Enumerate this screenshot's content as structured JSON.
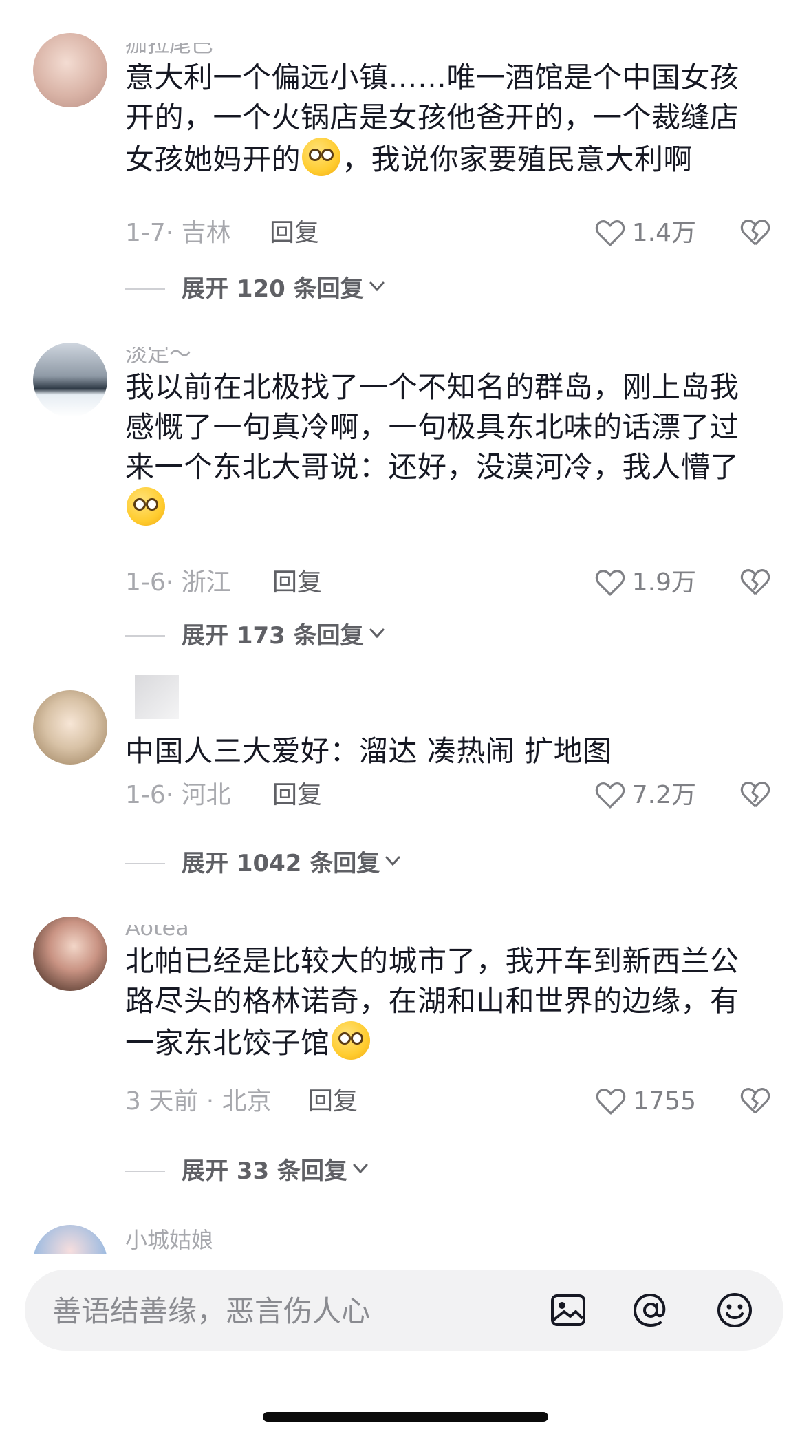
{
  "comments": [
    {
      "username": "痂拉尾巴",
      "text_before_emoji": "意大利一个偏远小镇……唯一酒馆是个中国女孩开的，一个火锅店是女孩他爸开的，一个裁缝店女孩她妈开的",
      "emoji": "face-with-wide-eyes-emoji",
      "text_after_emoji": "，我说你家要殖民意大利啊",
      "meta": "1-7· 吉林",
      "reply_label": "回复",
      "likes": "1.4万",
      "expand_label": "展开 120 条回复"
    },
    {
      "username": "淡定～",
      "text_before_emoji": "我以前在北极找了一个不知名的群岛，刚上岛我感慨了一句真冷啊，一句极具东北味的话漂了过来一个东北大哥说：还好，没漠河冷，我人懵了",
      "emoji": "dizzy-face-emoji",
      "text_after_emoji": "",
      "meta": "1-6· 浙江",
      "reply_label": "回复",
      "likes": "1.9万",
      "expand_label": "展开 173 条回复"
    },
    {
      "username": "",
      "text_before_emoji": "中国人三大爱好：溜达 凑热闹 扩地图",
      "emoji": "",
      "text_after_emoji": "",
      "meta": "1-6· 河北",
      "reply_label": "回复",
      "likes": "7.2万",
      "expand_label": "展开 1042 条回复"
    },
    {
      "username": "Aotea",
      "text_before_emoji": "北帕已经是比较大的城市了，我开车到新西兰公路尽头的格林诺奇，在湖和山和世界的边缘，有一家东北饺子馆",
      "emoji": "grinning-sweat-emoji",
      "text_after_emoji": "",
      "meta": "3 天前 · 北京",
      "reply_label": "回复",
      "likes": "1755",
      "expand_label": "展开 33 条回复"
    },
    {
      "username": "小城姑娘"
    }
  ],
  "input_bar": {
    "placeholder": "善语结善缘，恶言伤人心",
    "icons": [
      "image-icon",
      "at-icon",
      "emoji-icon"
    ]
  },
  "colors": {
    "primary_text": "#161823",
    "secondary_text": "#a7a8ad",
    "input_background": "#f2f2f3"
  }
}
